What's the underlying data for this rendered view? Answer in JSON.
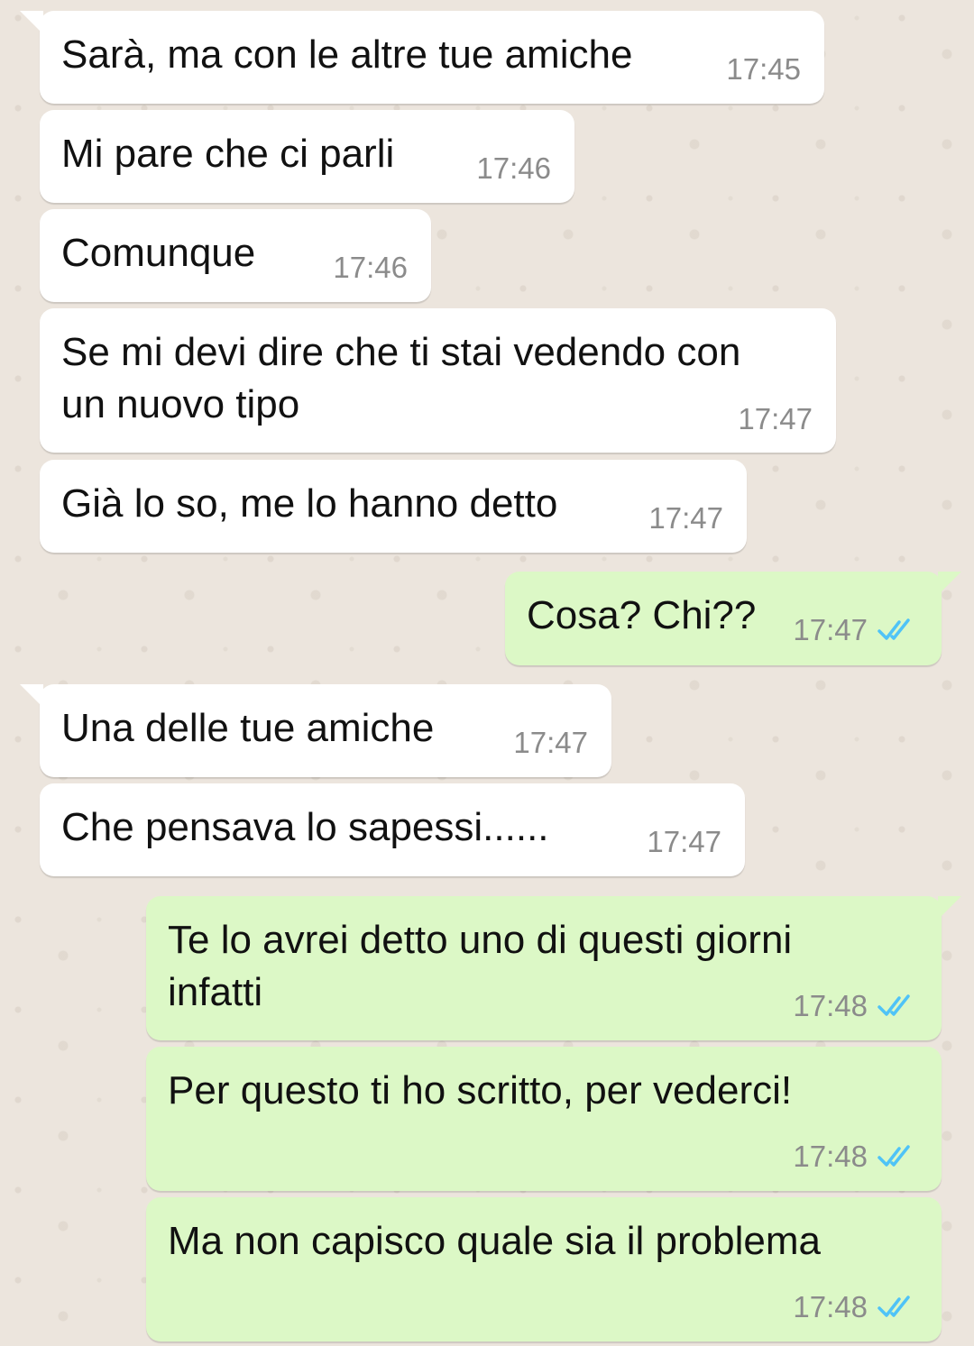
{
  "colors": {
    "incoming_bubble": "#ffffff",
    "outgoing_bubble": "#dcf8c6",
    "background": "#ece5dd",
    "read_ticks": "#4fc3f7"
  },
  "messages": [
    {
      "direction": "in",
      "text": "Sarà, ma con le altre tue amiche",
      "time": "17:45"
    },
    {
      "direction": "in",
      "text": "Mi pare che ci parli",
      "time": "17:46"
    },
    {
      "direction": "in",
      "text": "Comunque",
      "time": "17:46"
    },
    {
      "direction": "in",
      "text": "Se mi devi dire che ti stai vedendo con\nun nuovo tipo",
      "time": "17:47"
    },
    {
      "direction": "in",
      "text": "Già lo so, me lo hanno detto",
      "time": "17:47"
    },
    {
      "direction": "out",
      "text": "Cosa? Chi??",
      "time": "17:47",
      "status": "read"
    },
    {
      "direction": "in",
      "text": "Una delle tue amiche",
      "time": "17:47"
    },
    {
      "direction": "in",
      "text": "Che pensava lo sapessi......",
      "time": "17:47"
    },
    {
      "direction": "out",
      "text": "Te lo avrei detto uno di questi giorni\ninfatti",
      "time": "17:48",
      "status": "read"
    },
    {
      "direction": "out",
      "text": "Per questo ti ho scritto, per vederci!",
      "time": "17:48",
      "status": "read"
    },
    {
      "direction": "out",
      "text": "Ma non capisco quale sia il problema",
      "time": "17:48",
      "status": "read"
    }
  ]
}
